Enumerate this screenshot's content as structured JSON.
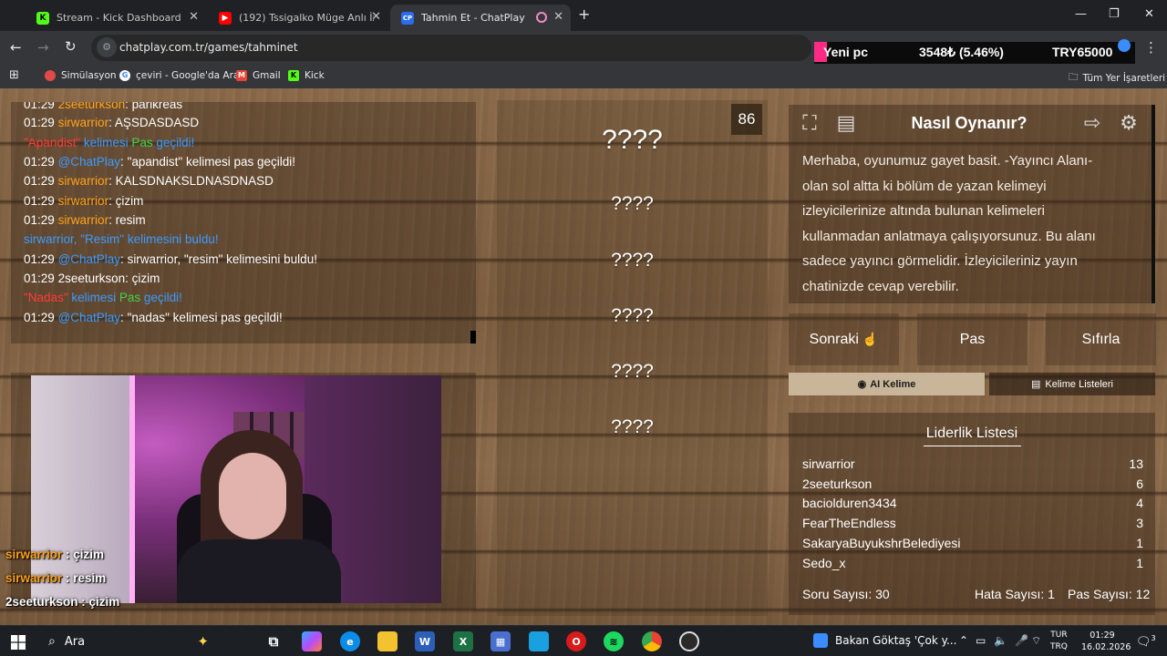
{
  "browser": {
    "tabs": [
      {
        "title": "Stream - Kick Dashboard",
        "favicon": "K",
        "color": "#53fc18"
      },
      {
        "title": "(192) Tssigalko Müge Anlı İzliyo",
        "favicon": "▶",
        "color": "#ff0000"
      },
      {
        "title": "Tahmin Et - ChatPlay",
        "favicon": "CP",
        "color": "#2b6cf0"
      }
    ],
    "url": "chatplay.com.tr/games/tahminet",
    "extension": {
      "label": "Yeni pc",
      "value": "3548₺ (5.46%)",
      "currency": "TRY65000"
    },
    "bookmarks": [
      {
        "label": "Simülasyon",
        "color": "#e04a4a"
      },
      {
        "label": "çeviri - Google'da Ara",
        "color": "#4285f4"
      },
      {
        "label": "Gmail",
        "color": "#ea4335"
      },
      {
        "label": "Kick",
        "color": "#53fc18"
      }
    ],
    "all_bookmarks": "Tüm Yer İşaretleri"
  },
  "chat": {
    "lines": [
      {
        "time": "01:29",
        "user": "2seeturkson",
        "text": "parikreas",
        "ucolor": "#ffa31a"
      },
      {
        "time": "01:29",
        "user": "sirwarrior",
        "text": "AŞSDASDASD",
        "ucolor": "#ffa31a"
      },
      {
        "system": "pass",
        "word": "\"Apandist\"",
        "mid": " kelimesi ",
        "pas": "Pas",
        "end": " geçildi!"
      },
      {
        "time": "01:29",
        "user": "@ChatPlay",
        "text": "\"apandist\" kelimesi pas geçildi!",
        "ucolor": "#3b9bff"
      },
      {
        "time": "01:29",
        "user": "sirwarrior",
        "text": "KALSDNAKSLDNASDNASD",
        "ucolor": "#ffa31a"
      },
      {
        "time": "01:29",
        "user": "sirwarrior",
        "text": "çizim",
        "ucolor": "#ffa31a"
      },
      {
        "time": "01:29",
        "user": "sirwarrior",
        "text": "resim",
        "ucolor": "#ffa31a"
      },
      {
        "system": "found",
        "text": "sirwarrior, \"Resim\" kelimesini buldu!"
      },
      {
        "time": "01:29",
        "user": "@ChatPlay",
        "text": "sirwarrior, \"resim\" kelimesini buldu!",
        "ucolor": "#3b9bff"
      },
      {
        "time": "01:29",
        "user": "2seeturkson",
        "text": "çizim",
        "ucolor": "#ffa31a"
      },
      {
        "system": "pass",
        "word": "\"Nadas\"",
        "mid": " kelimesi ",
        "pas": "Pas",
        "end": " geçildi!"
      },
      {
        "time": "01:29",
        "user": "@ChatPlay",
        "text": "\"nadas\" kelimesi pas geçildi!",
        "ucolor": "#3b9bff"
      }
    ]
  },
  "overlay": [
    {
      "user": "sirwarrior",
      "sep": " : ",
      "text": "çizim"
    },
    {
      "user": "sirwarrior",
      "sep": " : ",
      "text": "resim"
    },
    {
      "user": "2seeturkson",
      "sep": " : ",
      "text": "çizim"
    }
  ],
  "game": {
    "counter": "86",
    "words": [
      "????",
      "????",
      "????",
      "????",
      "????",
      "????"
    ]
  },
  "howto": {
    "title": "Nasıl Oynanır?",
    "text": "Merhaba, oyunumuz gayet basit. -Yayıncı Alanı- olan sol altta ki bölüm de yazan kelimeyi izleyicilerinize altında bulunan kelimeleri kullanmadan anlatmaya çalışıyorsunuz. Bu alanı sadece yayıncı görmelidir. İzleyicileriniz yayın chatinizde cevap verebilir."
  },
  "controls": {
    "next": "Sonraki",
    "pass": "Pas",
    "reset": "Sıfırla",
    "ai": "AI Kelime",
    "lists": "Kelime Listeleri"
  },
  "leaderboard": {
    "title": "Liderlik Listesi",
    "rows": [
      {
        "name": "sirwarrior",
        "score": "13"
      },
      {
        "name": "2seeturkson",
        "score": "6"
      },
      {
        "name": "baciolduren3434",
        "score": "4"
      },
      {
        "name": "FearTheEndless",
        "score": "3"
      },
      {
        "name": "SakaryaBuyukshrBelediyesi",
        "score": "1"
      },
      {
        "name": "Sedo_x",
        "score": "1"
      }
    ],
    "questions": "Soru Sayısı: 30",
    "errors": "Hata Sayısı: 1",
    "passes": "Pas Sayısı: 12"
  },
  "taskbar": {
    "search": "Ara",
    "news": "Bakan Göktaş 'Çok y...",
    "lang1": "TUR",
    "lang2": "TRQ",
    "time": "01:29",
    "date": "16.02.2026",
    "notifications": "3"
  }
}
